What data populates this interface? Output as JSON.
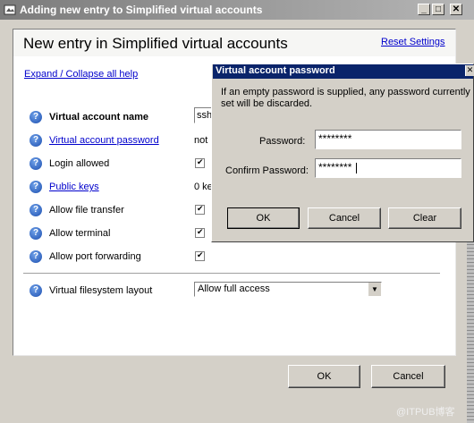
{
  "window": {
    "title": "Adding new entry to Simplified virtual accounts",
    "minimize_glyph": "_",
    "maximize_glyph": "□",
    "close_glyph": "✕"
  },
  "panel": {
    "title": "New entry in Simplified virtual accounts",
    "reset_link": "Reset Settings",
    "expand_link": "Expand / Collapse all help"
  },
  "fields": [
    {
      "label": "Virtual account name",
      "value": "ssh",
      "bold": true,
      "link": false
    },
    {
      "label": "Virtual account password",
      "value": "not",
      "bold": false,
      "link": true
    },
    {
      "label": "Login allowed",
      "checked": true,
      "link": false
    },
    {
      "label": "Public keys",
      "value": "0 ke",
      "link": true
    },
    {
      "label": "Allow file transfer",
      "checked": true,
      "link": false
    },
    {
      "label": "Allow terminal",
      "checked": true,
      "link": false
    },
    {
      "label": "Allow port forwarding",
      "checked": true,
      "link": false
    },
    {
      "label": "Virtual filesystem layout",
      "value": "Allow full access",
      "link": false
    }
  ],
  "footer": {
    "ok": "OK",
    "cancel": "Cancel"
  },
  "dialog": {
    "title": "Virtual account password",
    "close_glyph": "✕",
    "info": [
      "If an empty password is supplied, any password currently",
      "set will be discarded."
    ],
    "password_label": "Password:",
    "password_value": "********",
    "confirm_label": "Confirm Password:",
    "confirm_value": "********",
    "ok": "OK",
    "cancel": "Cancel",
    "clear": "Clear"
  },
  "help_glyph": "?",
  "watermark": "@ITPUB博客",
  "colors": {
    "dialog_title": "#0a246a",
    "link": "#0000cc",
    "help_icon": "#1d4fb0"
  }
}
